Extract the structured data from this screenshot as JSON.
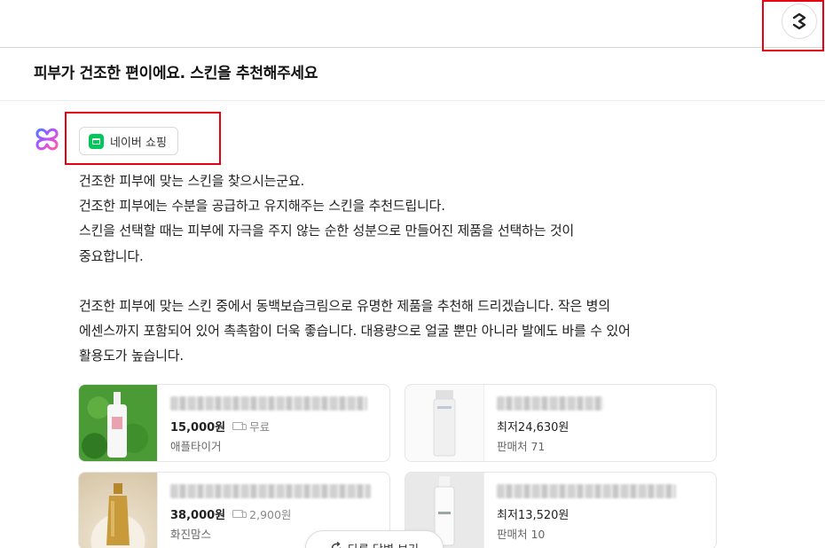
{
  "header": {
    "logo_icon": "s-logo-icon"
  },
  "question": {
    "text": "피부가 건조한 편이에요. 스킨을 추천해주세요"
  },
  "source_chip": {
    "label": "네이버 쇼핑",
    "icon": "naver-shopping-icon",
    "color": "#03c75a"
  },
  "answer": {
    "paragraph1": [
      "건조한 피부에 맞는 스킨을 찾으시는군요.",
      "건조한 피부에는 수분을 공급하고 유지해주는 스킨을 추천드립니다.",
      "스킨을 선택할 때는 피부에 자극을 주지 않는 순한 성분으로 만들어진 제품을 선택하는 것이",
      "중요합니다."
    ],
    "paragraph2": [
      "건조한 피부에 맞는 스킨 중에서 동백보습크림으로 유명한 제품을 추천해 드리겠습니다. 작은 병의",
      "에센스까지 포함되어 있어 촉촉함이 더욱 좋습니다. 대용량으로 얼굴 뿐만 아니라 발에도 바를 수 있어",
      "활용도가 높습니다."
    ]
  },
  "products": [
    {
      "price": "15,000원",
      "shipping": "무료",
      "seller": "애플타이거"
    },
    {
      "price": "최저24,630원",
      "shipping": "",
      "seller": "판매처 71"
    },
    {
      "price": "38,000원",
      "shipping": "2,900원",
      "seller": "화진맘스"
    },
    {
      "price": "최저13,520원",
      "shipping": "",
      "seller": "판매처 10"
    }
  ],
  "redo_button": {
    "label": "다른 답변 보기",
    "icon": "refresh-icon"
  }
}
